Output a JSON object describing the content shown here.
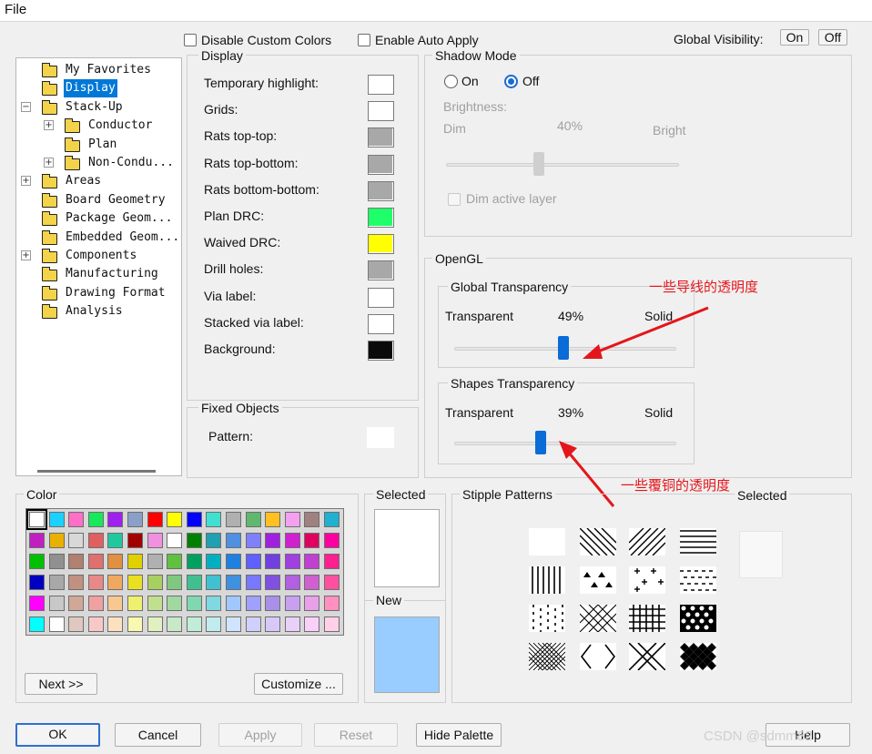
{
  "menu": {
    "file": "File"
  },
  "header": {
    "disable_custom_colors": "Disable Custom Colors",
    "enable_auto_apply": "Enable Auto Apply",
    "global_visibility": "Global Visibility:",
    "on": "On",
    "off": "Off"
  },
  "tree": [
    {
      "label": "My Favorites",
      "level": 1,
      "expander": ""
    },
    {
      "label": "Display",
      "level": 1,
      "expander": "",
      "selected": true
    },
    {
      "label": "Stack-Up",
      "level": 1,
      "expander": "−",
      "open": true
    },
    {
      "label": "Conductor",
      "level": 2,
      "expander": "+"
    },
    {
      "label": "Plan",
      "level": 2,
      "expander": ""
    },
    {
      "label": "Non-Condu...",
      "level": 2,
      "expander": "+"
    },
    {
      "label": "Areas",
      "level": 1,
      "expander": "+"
    },
    {
      "label": "Board Geometry",
      "level": 1,
      "expander": ""
    },
    {
      "label": "Package Geom...",
      "level": 1,
      "expander": ""
    },
    {
      "label": "Embedded Geom...",
      "level": 1,
      "expander": ""
    },
    {
      "label": "Components",
      "level": 1,
      "expander": "+"
    },
    {
      "label": "Manufacturing",
      "level": 1,
      "expander": ""
    },
    {
      "label": "Drawing Format",
      "level": 1,
      "expander": ""
    },
    {
      "label": "Analysis",
      "level": 1,
      "expander": ""
    }
  ],
  "display": {
    "title": "Display",
    "rows": [
      {
        "label": "Temporary highlight:",
        "color": "#ffffff"
      },
      {
        "label": "Grids:",
        "color": "#ffffff"
      },
      {
        "label": "Rats top-top:",
        "color": "#a8a8a8"
      },
      {
        "label": "Rats top-bottom:",
        "color": "#a8a8a8"
      },
      {
        "label": "Rats bottom-bottom:",
        "color": "#a8a8a8"
      },
      {
        "label": "Plan DRC:",
        "color": "#1fff6a"
      },
      {
        "label": "Waived DRC:",
        "color": "#ffff00"
      },
      {
        "label": "Drill holes:",
        "color": "#a8a8a8"
      },
      {
        "label": "Via label:",
        "color": "#ffffff"
      },
      {
        "label": "Stacked via label:",
        "color": "#ffffff"
      },
      {
        "label": "Background:",
        "color": "#0a0a0a"
      }
    ]
  },
  "fixed_objects": {
    "title": "Fixed Objects",
    "pattern_label": "Pattern:"
  },
  "shadow": {
    "title": "Shadow Mode",
    "on": "On",
    "off": "Off",
    "selected": "Off",
    "brightness": "Brightness:",
    "dim": "Dim",
    "value": "40%",
    "bright": "Bright",
    "level": 0.4,
    "dim_active_layer": "Dim active layer"
  },
  "opengl": {
    "title": "OpenGL",
    "global": {
      "title": "Global Transparency",
      "left": "Transparent",
      "value": "49%",
      "right": "Solid",
      "level": 0.49
    },
    "shapes": {
      "title": "Shapes Transparency",
      "left": "Transparent",
      "value": "39%",
      "right": "Solid",
      "level": 0.39
    }
  },
  "color": {
    "title": "Color",
    "palette": [
      [
        "#ffffff",
        "#1ad1ff",
        "#ff6ec7",
        "#19e85a",
        "#a020f0",
        "#8aa0c8",
        "#ff0000",
        "#ffff00",
        "#0000ff",
        "#40e0d0",
        "#b0b0b0",
        "#5fb86e",
        "#ffc020",
        "#f4a0f0",
        "#a08080",
        "#20b0d0"
      ],
      [
        "#c020c0",
        "#e8b000",
        "#d8d8d8",
        "#e06060",
        "#20c8a0",
        "#a00000",
        "#f090e0",
        "#ffffff",
        "#008000",
        "#20a0b0",
        "#5090e0",
        "#8080ff",
        "#a020e0",
        "#d020d0",
        "#e00060",
        "#ff00a0"
      ],
      [
        "#00c000",
        "#909090",
        "#b08070",
        "#e07070",
        "#e09040",
        "#e0d000",
        "#b0b0b0",
        "#60c040",
        "#00a060",
        "#00b0c0",
        "#2080e0",
        "#6060ff",
        "#7040e0",
        "#a040e0",
        "#c040d0",
        "#ff2090"
      ],
      [
        "#0000c0",
        "#a8a8a8",
        "#c09080",
        "#e88888",
        "#f0a860",
        "#e8e020",
        "#a8d060",
        "#80c880",
        "#40c090",
        "#40c0d0",
        "#4090e0",
        "#7878ff",
        "#8050e0",
        "#b060e0",
        "#d060d0",
        "#ff50a0"
      ],
      [
        "#ff00ff",
        "#c8c8c8",
        "#d0a898",
        "#f0a0a0",
        "#f8c890",
        "#f0f070",
        "#c0e090",
        "#a0d8a0",
        "#80d8b0",
        "#80d8e0",
        "#a0c8ff",
        "#a0a0ff",
        "#a890e8",
        "#c8a0f0",
        "#e8a0e8",
        "#ff90c0"
      ],
      [
        "#00ffff",
        "#ffffff",
        "#e0c8c0",
        "#f8c8c8",
        "#fce0c0",
        "#f8f8b0",
        "#e0f0c0",
        "#c8e8c8",
        "#c0ecd8",
        "#c0ecf0",
        "#d0e4ff",
        "#d0d0ff",
        "#d8c8f8",
        "#e8d0f8",
        "#f8d0f8",
        "#ffd0e8"
      ]
    ],
    "next": "Next >>",
    "customize": "Customize ..."
  },
  "selected_panel": {
    "title": "Selected",
    "new_title": "New",
    "selected_color": "#ffffff",
    "new_color": "#99ccff"
  },
  "stipple": {
    "title": "Stipple Patterns",
    "selected_title": "Selected"
  },
  "buttons": {
    "ok": "OK",
    "cancel": "Cancel",
    "apply": "Apply",
    "reset": "Reset",
    "hide_palette": "Hide Palette",
    "help": "Help"
  },
  "annotations": {
    "global": "一些导线的透明度",
    "shapes": "一些覆铜的透明度"
  },
  "watermark": "CSDN @sdmm82",
  "colors": {
    "accent": "#0a6cd6",
    "annotation": "#e4161b"
  }
}
